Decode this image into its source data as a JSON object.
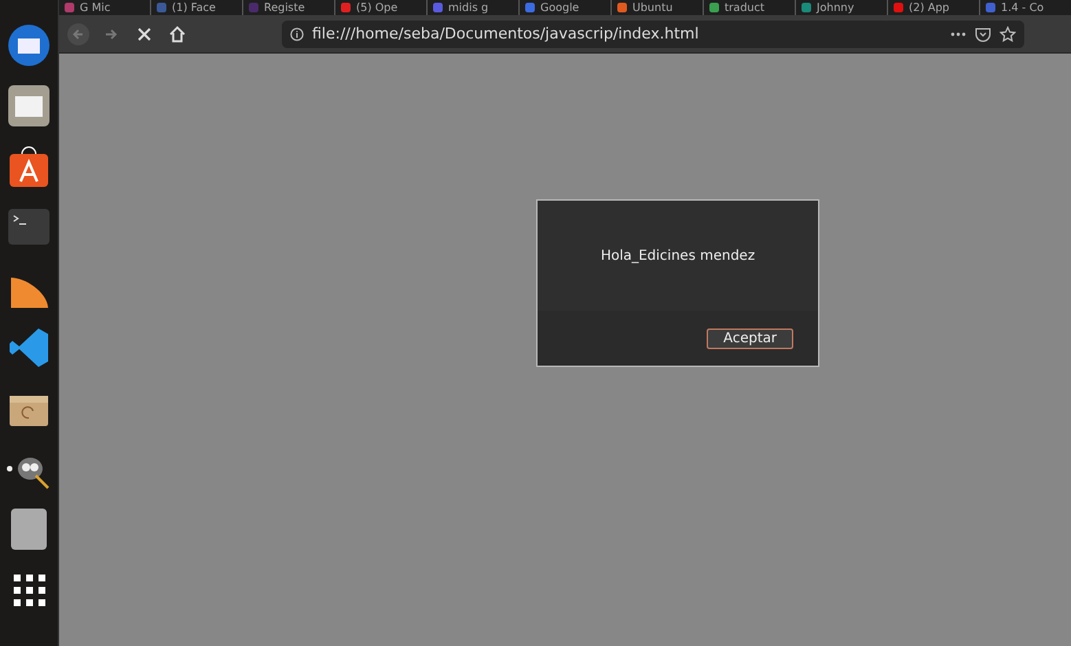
{
  "browser": {
    "tabs": [
      {
        "label": "G Mic",
        "color": "#b03a6a"
      },
      {
        "label": "(1) Face",
        "color": "#3b5998"
      },
      {
        "label": "Registe",
        "color": "#4a2a6a"
      },
      {
        "label": "(5) Ope",
        "color": "#e02020"
      },
      {
        "label": "midis g",
        "color": "#5a5ae0"
      },
      {
        "label": "Google",
        "color": "#3b6be0"
      },
      {
        "label": "Ubuntu",
        "color": "#e05a20"
      },
      {
        "label": "traduct",
        "color": "#3aa050"
      },
      {
        "label": "Johnny",
        "color": "#1a8a7a"
      },
      {
        "label": "(2) App",
        "color": "#e01010"
      },
      {
        "label": "1.4 - Co",
        "color": "#4060d0"
      }
    ],
    "url": "file:///home/seba/Documentos/javascrip/index.html"
  },
  "dialog": {
    "message": "Hola_Edicines mendez",
    "buttons": [
      "Aceptar"
    ]
  }
}
